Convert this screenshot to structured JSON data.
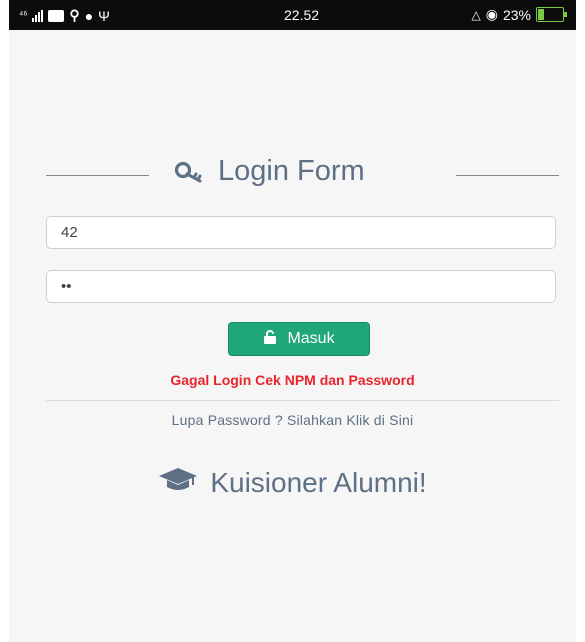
{
  "status_bar": {
    "time": "22.52",
    "battery_percent": "23%",
    "battery_level": 0.23,
    "left_icons": [
      "sim-signal-icon",
      "message-icon",
      "notification-icon",
      "cat-app-icon",
      "usb-icon"
    ],
    "right_icons": [
      "silent-icon",
      "eye-comfort-icon",
      "battery-icon"
    ]
  },
  "login": {
    "title": "Login Form",
    "title_icon": "key-icon",
    "username_value": "42",
    "password_value": "••",
    "submit_label": "Masuk",
    "submit_icon": "unlock-icon",
    "error_message": "Gagal Login Cek NPM dan Password",
    "forgot_text": "Lupa Password ? Silahkan Klik di Sini"
  },
  "brand": {
    "text": "Kuisioner Alumni!",
    "icon": "graduation-cap-icon"
  },
  "colors": {
    "accent_green": "#1fa67a",
    "error_red": "#e8232b",
    "heading_slate": "#5d7085"
  }
}
